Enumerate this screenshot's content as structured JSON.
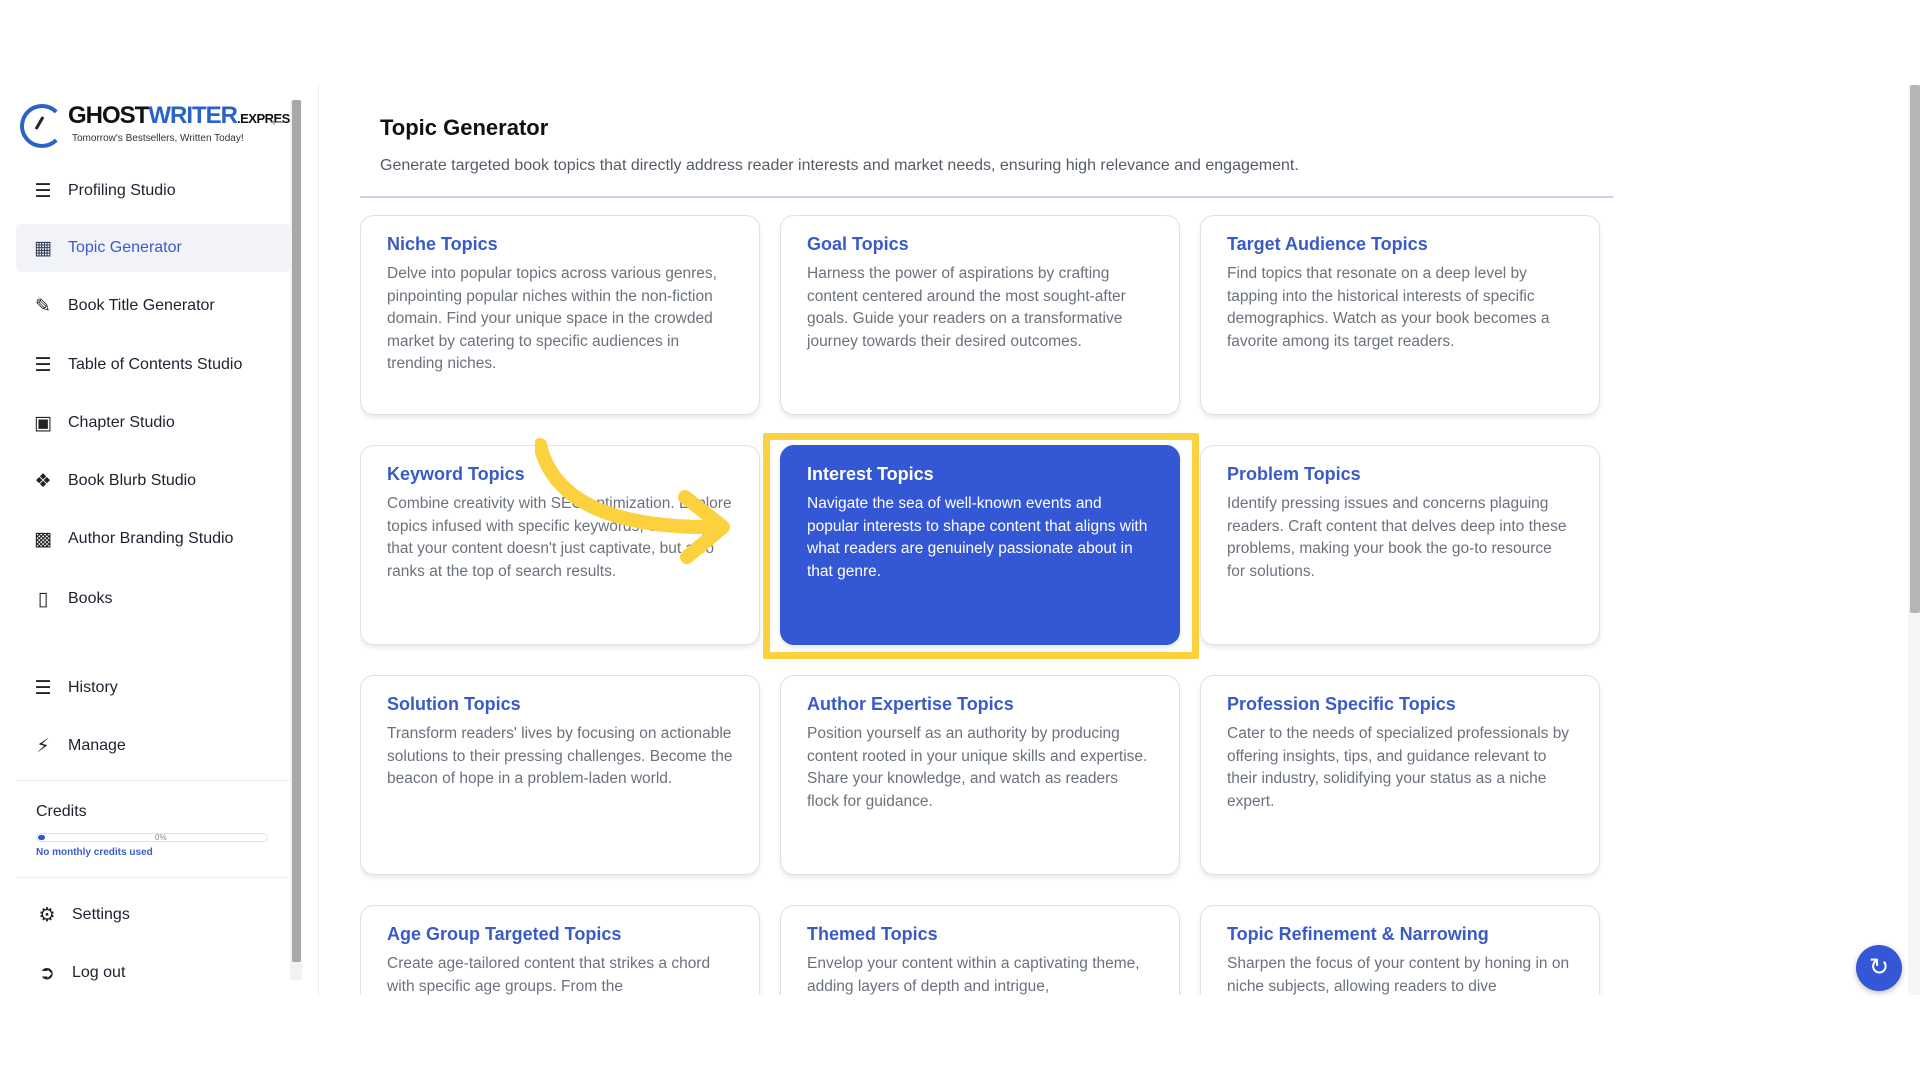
{
  "logo": {
    "title_a": "GHOST",
    "title_b": "WRITER",
    "title_c": ".EXPRESS",
    "tagline": "Tomorrow's Bestsellers, Written Today!"
  },
  "sidebar": {
    "collapse_icon": "arrow-left-icon",
    "items": [
      {
        "label": "Profiling Studio",
        "icon": "profile-list-icon"
      },
      {
        "label": "Topic Generator",
        "icon": "topic-table-icon",
        "active": true
      },
      {
        "label": "Book Title Generator",
        "icon": "book-pen-icon"
      },
      {
        "label": "Table of Contents Studio",
        "icon": "contents-list-icon"
      },
      {
        "label": "Chapter Studio",
        "icon": "chapter-book-icon"
      },
      {
        "label": "Book Blurb Studio",
        "icon": "blurb-icon"
      },
      {
        "label": "Author Branding Studio",
        "icon": "branding-icon"
      },
      {
        "label": "Books",
        "icon": "books-icon"
      },
      {
        "label": "History",
        "icon": "history-list-icon"
      },
      {
        "label": "Manage",
        "icon": "lightning-icon"
      }
    ],
    "credits": {
      "title": "Credits",
      "percent_label": "0%",
      "percent_value": 0,
      "note": "No monthly credits used"
    },
    "footer": [
      {
        "label": "Settings",
        "icon": "gears-icon"
      },
      {
        "label": "Log out",
        "icon": "logout-icon"
      }
    ]
  },
  "main": {
    "title": "Topic Generator",
    "subtitle": "Generate targeted book topics that directly address reader interests and market needs, ensuring high relevance and engagement.",
    "cards": [
      {
        "title": "Niche Topics",
        "desc": "Delve into popular topics across various genres, pinpointing popular niches within the non-fiction domain. Find your unique space in the crowded market by catering to specific audiences in trending niches."
      },
      {
        "title": "Goal Topics",
        "desc": "Harness the power of aspirations by crafting content centered around the most sought-after goals. Guide your readers on a transformative journey towards their desired outcomes."
      },
      {
        "title": "Target Audience Topics",
        "desc": "Find topics that resonate on a deep level by tapping into the historical interests of specific demographics. Watch as your book becomes a favorite among its target readers."
      },
      {
        "title": "Keyword Topics",
        "desc": "Combine creativity with SEO optimization. Explore topics infused with specific keywords, ensuring that your content doesn't just captivate, but also ranks at the top of search results."
      },
      {
        "title": "Interest Topics",
        "desc": "Navigate the sea of well-known events and popular interests to shape content that aligns with what readers are genuinely passionate about in that genre.",
        "selected": true
      },
      {
        "title": "Problem Topics",
        "desc": "Identify pressing issues and concerns plaguing readers. Craft content that delves deep into these problems, making your book the go-to resource for solutions."
      },
      {
        "title": "Solution Topics",
        "desc": "Transform readers' lives by focusing on actionable solutions to their pressing challenges. Become the beacon of hope in a problem-laden world."
      },
      {
        "title": "Author Expertise Topics",
        "desc": "Position yourself as an authority by producing content rooted in your unique skills and expertise. Share your knowledge, and watch as readers flock for guidance."
      },
      {
        "title": "Profession Specific Topics",
        "desc": "Cater to the needs of specialized professionals by offering insights, tips, and guidance relevant to their industry, solidifying your status as a niche expert."
      },
      {
        "title": "Age Group Targeted Topics",
        "desc": "Create age-tailored content that strikes a chord with specific age groups. From the"
      },
      {
        "title": "Themed Topics",
        "desc": "Envelop your content within a captivating theme, adding layers of depth and intrigue,"
      },
      {
        "title": "Topic Refinement & Narrowing",
        "desc": "Sharpen the focus of your content by honing in on niche subjects, allowing readers to dive"
      }
    ]
  },
  "colors": {
    "accent": "#3457d5",
    "card_title": "#3a5bc7",
    "highlight": "#fbd13d"
  },
  "fab_icon": "refresh-icon"
}
